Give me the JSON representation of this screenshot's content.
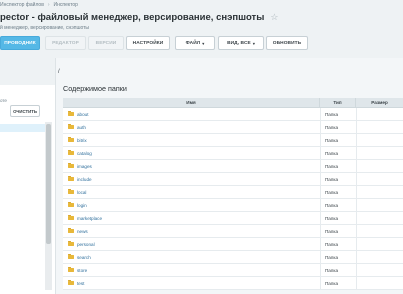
{
  "breadcrumb": [
    "Инспектор файлов",
    "Инспектор"
  ],
  "title": "pector - файловый менеджер, версирование, снэпшоты",
  "subtitle": "й менеджер, версирование, снэпшоты",
  "toolbar": {
    "explorer": "ПРОВОДНИК",
    "editor": "РЕДАКТОР",
    "versions": "ВЕРСИИ",
    "settings": "НАСТРОЙКИ",
    "file": "ФАЙЛ",
    "view": "ВИД, ВСЕ",
    "refresh": "ОБНОВИТЬ"
  },
  "left_panel": {
    "label": "оте",
    "clear_button": "ОЧИСТИТЬ"
  },
  "main": {
    "path": "/",
    "panel_title": "Содержимое папки",
    "columns": {
      "name": "Имя",
      "type": "Тип",
      "size": "Размер"
    },
    "rows": [
      {
        "name": "about",
        "type": "Папка"
      },
      {
        "name": "auth",
        "type": "Папка"
      },
      {
        "name": "bitrix",
        "type": "Папка"
      },
      {
        "name": "catalog",
        "type": "Папка"
      },
      {
        "name": "images",
        "type": "Папка"
      },
      {
        "name": "include",
        "type": "Папка"
      },
      {
        "name": "local",
        "type": "Папка"
      },
      {
        "name": "login",
        "type": "Папка"
      },
      {
        "name": "marketplace",
        "type": "Папка"
      },
      {
        "name": "news",
        "type": "Папка"
      },
      {
        "name": "personal",
        "type": "Папка"
      },
      {
        "name": "search",
        "type": "Папка"
      },
      {
        "name": "store",
        "type": "Папка"
      },
      {
        "name": "test",
        "type": "Папка"
      }
    ]
  }
}
